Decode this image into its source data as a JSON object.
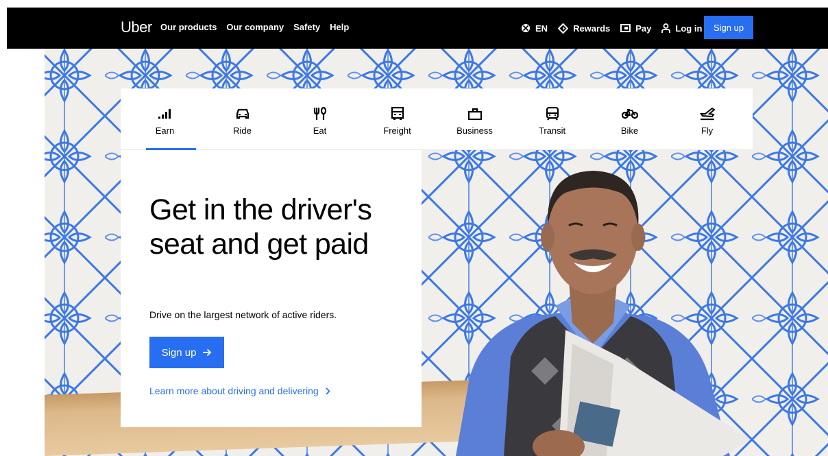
{
  "nav": {
    "logo": "Uber",
    "links": [
      "Our products",
      "Our company",
      "Safety",
      "Help"
    ],
    "language": "EN",
    "rewards": "Rewards",
    "pay": "Pay",
    "login": "Log in",
    "signup": "Sign up"
  },
  "tabs": [
    {
      "label": "Earn",
      "icon": "signal-bars-icon",
      "active": true
    },
    {
      "label": "Ride",
      "icon": "car-icon"
    },
    {
      "label": "Eat",
      "icon": "utensils-icon"
    },
    {
      "label": "Freight",
      "icon": "truck-icon"
    },
    {
      "label": "Business",
      "icon": "briefcase-icon"
    },
    {
      "label": "Transit",
      "icon": "bus-icon"
    },
    {
      "label": "Bike",
      "icon": "bike-icon"
    },
    {
      "label": "Fly",
      "icon": "airplane-icon"
    }
  ],
  "hero": {
    "headline": "Get in the driver's seat and get paid",
    "subtext": "Drive on the largest network of active riders.",
    "cta": "Sign up",
    "learn_more": "Learn more about driving and delivering"
  },
  "colors": {
    "accent": "#276ef1",
    "nav_bg": "#000000",
    "pattern": "#3c78e6"
  }
}
